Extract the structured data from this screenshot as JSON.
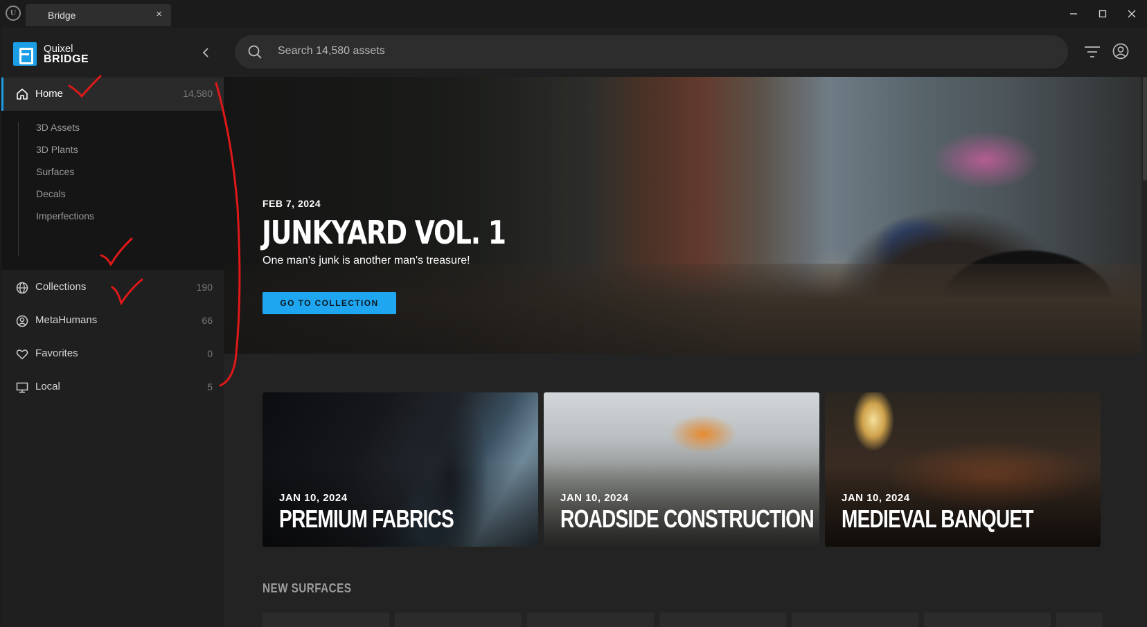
{
  "window": {
    "tab_title": "Bridge",
    "tab_close": "×"
  },
  "brand": {
    "line1": "Quixel",
    "line2": "BRIDGE"
  },
  "sidebar": {
    "home": {
      "label": "Home",
      "count": "14,580"
    },
    "sub_items": [
      "3D Assets",
      "3D Plants",
      "Surfaces",
      "Decals",
      "Imperfections"
    ],
    "items": [
      {
        "label": "Collections",
        "count": "190",
        "icon": "globe-icon"
      },
      {
        "label": "MetaHumans",
        "count": "66",
        "icon": "user-circle-icon"
      },
      {
        "label": "Favorites",
        "count": "0",
        "icon": "heart-icon"
      },
      {
        "label": "Local",
        "count": "5",
        "icon": "monitor-icon"
      }
    ]
  },
  "search": {
    "placeholder": "Search 14,580 assets"
  },
  "hero": {
    "date": "FEB 7, 2024",
    "title": "JUNKYARD VOL. 1",
    "subtitle": "One man's junk is another man's treasure!",
    "button": "GO TO COLLECTION"
  },
  "cards": [
    {
      "date": "JAN 10, 2024",
      "title": "PREMIUM FABRICS"
    },
    {
      "date": "JAN 10, 2024",
      "title": "ROADSIDE CONSTRUCTION"
    },
    {
      "date": "JAN 10, 2024",
      "title": "MEDIEVAL BANQUET"
    }
  ],
  "sections": {
    "new_surfaces": "NEW SURFACES"
  },
  "colors": {
    "accent": "#1fa6f0",
    "annotation": "#e01818"
  }
}
